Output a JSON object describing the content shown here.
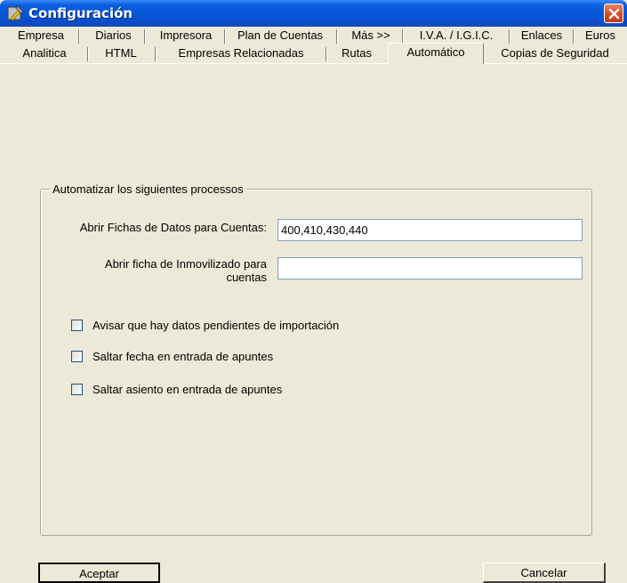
{
  "window": {
    "title": "Configuración",
    "close_label": "✕"
  },
  "tabs_row1": [
    {
      "label": "Empresa"
    },
    {
      "label": "Diarios"
    },
    {
      "label": "Impresora"
    },
    {
      "label": "Plan de Cuentas"
    },
    {
      "label": "Más >>"
    },
    {
      "label": "I.V.A. / I.G.I.C."
    },
    {
      "label": "Enlaces"
    },
    {
      "label": "Euros"
    }
  ],
  "tabs_row2": [
    {
      "label": "Analitica"
    },
    {
      "label": "HTML"
    },
    {
      "label": "Empresas Relacionadas"
    },
    {
      "label": "Rutas"
    },
    {
      "label": "Automático",
      "active": true
    },
    {
      "label": "Copias de Seguridad"
    }
  ],
  "group": {
    "legend": "Automatizar los siguientes processos"
  },
  "fields": {
    "fichas_label": "Abrir Fichas de Datos para Cuentas:",
    "fichas_value": "400,410,430,440",
    "inmov_label_line1": "Abrir ficha de Inmovilizado para",
    "inmov_label_line2": "cuentas",
    "inmov_value": ""
  },
  "checkboxes": [
    {
      "label": "Avisar que hay datos pendientes de importación",
      "checked": false
    },
    {
      "label": "Saltar fecha en entrada de apuntes",
      "checked": false
    },
    {
      "label": "Saltar asiento en entrada de apuntes",
      "checked": false
    }
  ],
  "buttons": {
    "accept": "Aceptar",
    "cancel": "Cancelar"
  },
  "colors": {
    "titlebar": "#0654d8",
    "window_bg": "#ece9d8",
    "close_button": "#d4502c"
  }
}
